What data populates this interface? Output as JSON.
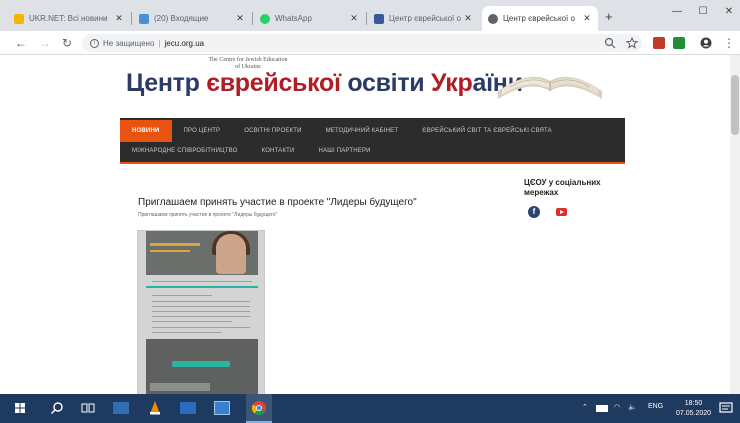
{
  "tabs": [
    {
      "label": "UKR.NET: Всі новини",
      "favicon_color": "#f5b400"
    },
    {
      "label": "(20) Входящие",
      "favicon_color": "#4a90d9"
    },
    {
      "label": "WhatsApp",
      "favicon_color": "#25d366"
    },
    {
      "label": "Центр єврейської о",
      "favicon_color": "#3b5998"
    },
    {
      "label": "Центр єврейської о",
      "favicon_color": "#5f6368"
    }
  ],
  "address_bar": {
    "security": "Не защищено",
    "url": "jecu.org.ua"
  },
  "site": {
    "subtitle_en": "The Centre for Jewish Education of Ukraine",
    "title_part1": "Центр ",
    "title_part2": "єврейської",
    "title_part3": " освіти ",
    "title_part4": "Укр",
    "title_part5": "аїни"
  },
  "menu_row1": [
    "Новини",
    "Про центр",
    "Освітні проекти",
    "Методичний кабінет",
    "Єврейський світ та єврейські свята"
  ],
  "menu_row2": [
    "Міжнародне співробітництво",
    "Контакти",
    "Наші партнери"
  ],
  "post": {
    "title": "Приглашаем принять участие в проекте \"Лидеры будущего\"",
    "subtitle": "Приглашаем принять участие в проекте \"Лидеры будущего\""
  },
  "sidebar": {
    "title": "ЦЄОУ у соціальних мережах"
  },
  "taskbar": {
    "lang": "ENG",
    "time": "18:50",
    "date": "07.05.2020"
  },
  "colors": {
    "accent": "#e8540f",
    "menu_bg": "#2c2c2c",
    "title_blue": "#2b3b68",
    "title_red": "#b01d24"
  }
}
